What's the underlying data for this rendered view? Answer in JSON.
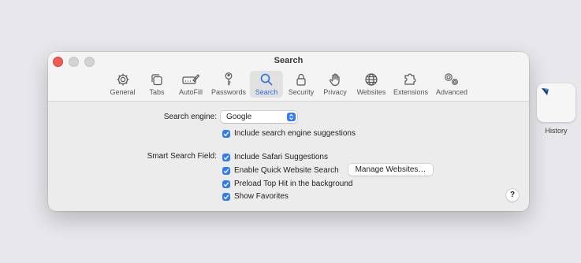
{
  "window": {
    "title": "Search"
  },
  "toolbar": {
    "tabs": [
      {
        "label": "General",
        "icon": "gear-icon"
      },
      {
        "label": "Tabs",
        "icon": "tabs-icon"
      },
      {
        "label": "AutoFill",
        "icon": "autofill-pencil-icon"
      },
      {
        "label": "Passwords",
        "icon": "key-icon"
      },
      {
        "label": "Search",
        "icon": "magnifier-icon",
        "active": true
      },
      {
        "label": "Security",
        "icon": "lock-icon"
      },
      {
        "label": "Privacy",
        "icon": "hand-icon"
      },
      {
        "label": "Websites",
        "icon": "globe-icon"
      },
      {
        "label": "Extensions",
        "icon": "puzzle-icon"
      },
      {
        "label": "Advanced",
        "icon": "gears-icon"
      }
    ]
  },
  "search": {
    "engine_label": "Search engine:",
    "engine_value": "Google",
    "suggestions_label": "Include search engine suggestions",
    "suggestions_checked": true,
    "smart_field_label": "Smart Search Field:",
    "options": [
      {
        "label": "Include Safari Suggestions",
        "checked": true
      },
      {
        "label": "Enable Quick Website Search",
        "checked": true
      },
      {
        "label": "Preload Top Hit in the background",
        "checked": true
      },
      {
        "label": "Show Favorites",
        "checked": true
      }
    ],
    "manage_button": "Manage Websites…",
    "help": "?"
  },
  "desktop": {
    "widget_label": "History"
  },
  "colors": {
    "accent": "#2f7cf6",
    "close": "#ee5b53"
  }
}
